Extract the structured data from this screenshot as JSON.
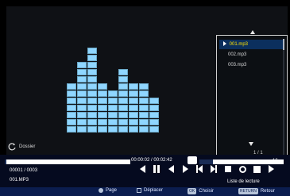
{
  "playlist": {
    "items": [
      "001.mp3",
      "002.mp3",
      "003.mp3"
    ],
    "selected_index": 0,
    "page": "1 / 1"
  },
  "dossier_label": "Dossier",
  "playback": {
    "time": "00:00:02 / 00:02:42",
    "progress": 0.0125,
    "volume_level": "16",
    "volume_fraction": 0.16,
    "counter": "00001 / 0003",
    "file_name": "001.MP3",
    "list_label": "Liste de lecture"
  },
  "footer": {
    "page": "Page",
    "deplacer": "Déplacer",
    "ok_key": "OK",
    "choisir": "Choisir",
    "return_key": "RETURN",
    "retour": "Retour"
  },
  "controls": [
    {
      "name": "prev-icon"
    },
    {
      "name": "pause-icon"
    },
    {
      "name": "rewind-icon"
    },
    {
      "name": "play-icon"
    },
    {
      "name": "skip-back-icon"
    },
    {
      "name": "skip-forward-icon"
    },
    {
      "name": "stop-icon"
    },
    {
      "name": "repeat-icon"
    },
    {
      "name": "playlist-icon"
    },
    {
      "name": "next-icon"
    }
  ],
  "equalizer_levels": [
    7,
    10,
    12,
    7,
    6,
    9,
    7,
    7,
    5
  ],
  "colors": {
    "eq_fill": "#8fd6ff",
    "accent_blue": "#0b2f5d",
    "selected_text": "#ffe400"
  }
}
